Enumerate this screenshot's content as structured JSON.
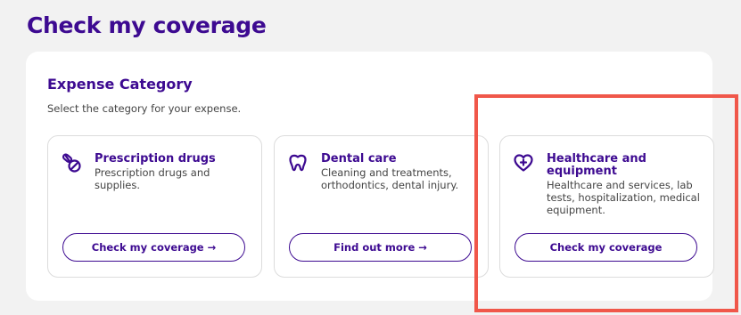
{
  "page": {
    "title": "Check my coverage"
  },
  "section": {
    "title": "Expense Category",
    "subtitle": "Select the category for your expense."
  },
  "cards": [
    {
      "icon": "pill-icon",
      "title": "Prescription drugs",
      "description": "Prescription drugs and supplies.",
      "button_label": "Check my coverage →"
    },
    {
      "icon": "tooth-icon",
      "title": "Dental care",
      "description": "Cleaning and treatments, orthodontics, dental injury.",
      "button_label": "Find out more →"
    },
    {
      "icon": "heart-plus-icon",
      "title": "Healthcare and equipment",
      "description": "Healthcare and services, lab tests, hospitalization, medical equipment.",
      "button_label": "Check my coverage"
    }
  ],
  "colors": {
    "brand": "#3d0a91",
    "highlight": "#f0574a",
    "background": "#f2f2f2"
  }
}
